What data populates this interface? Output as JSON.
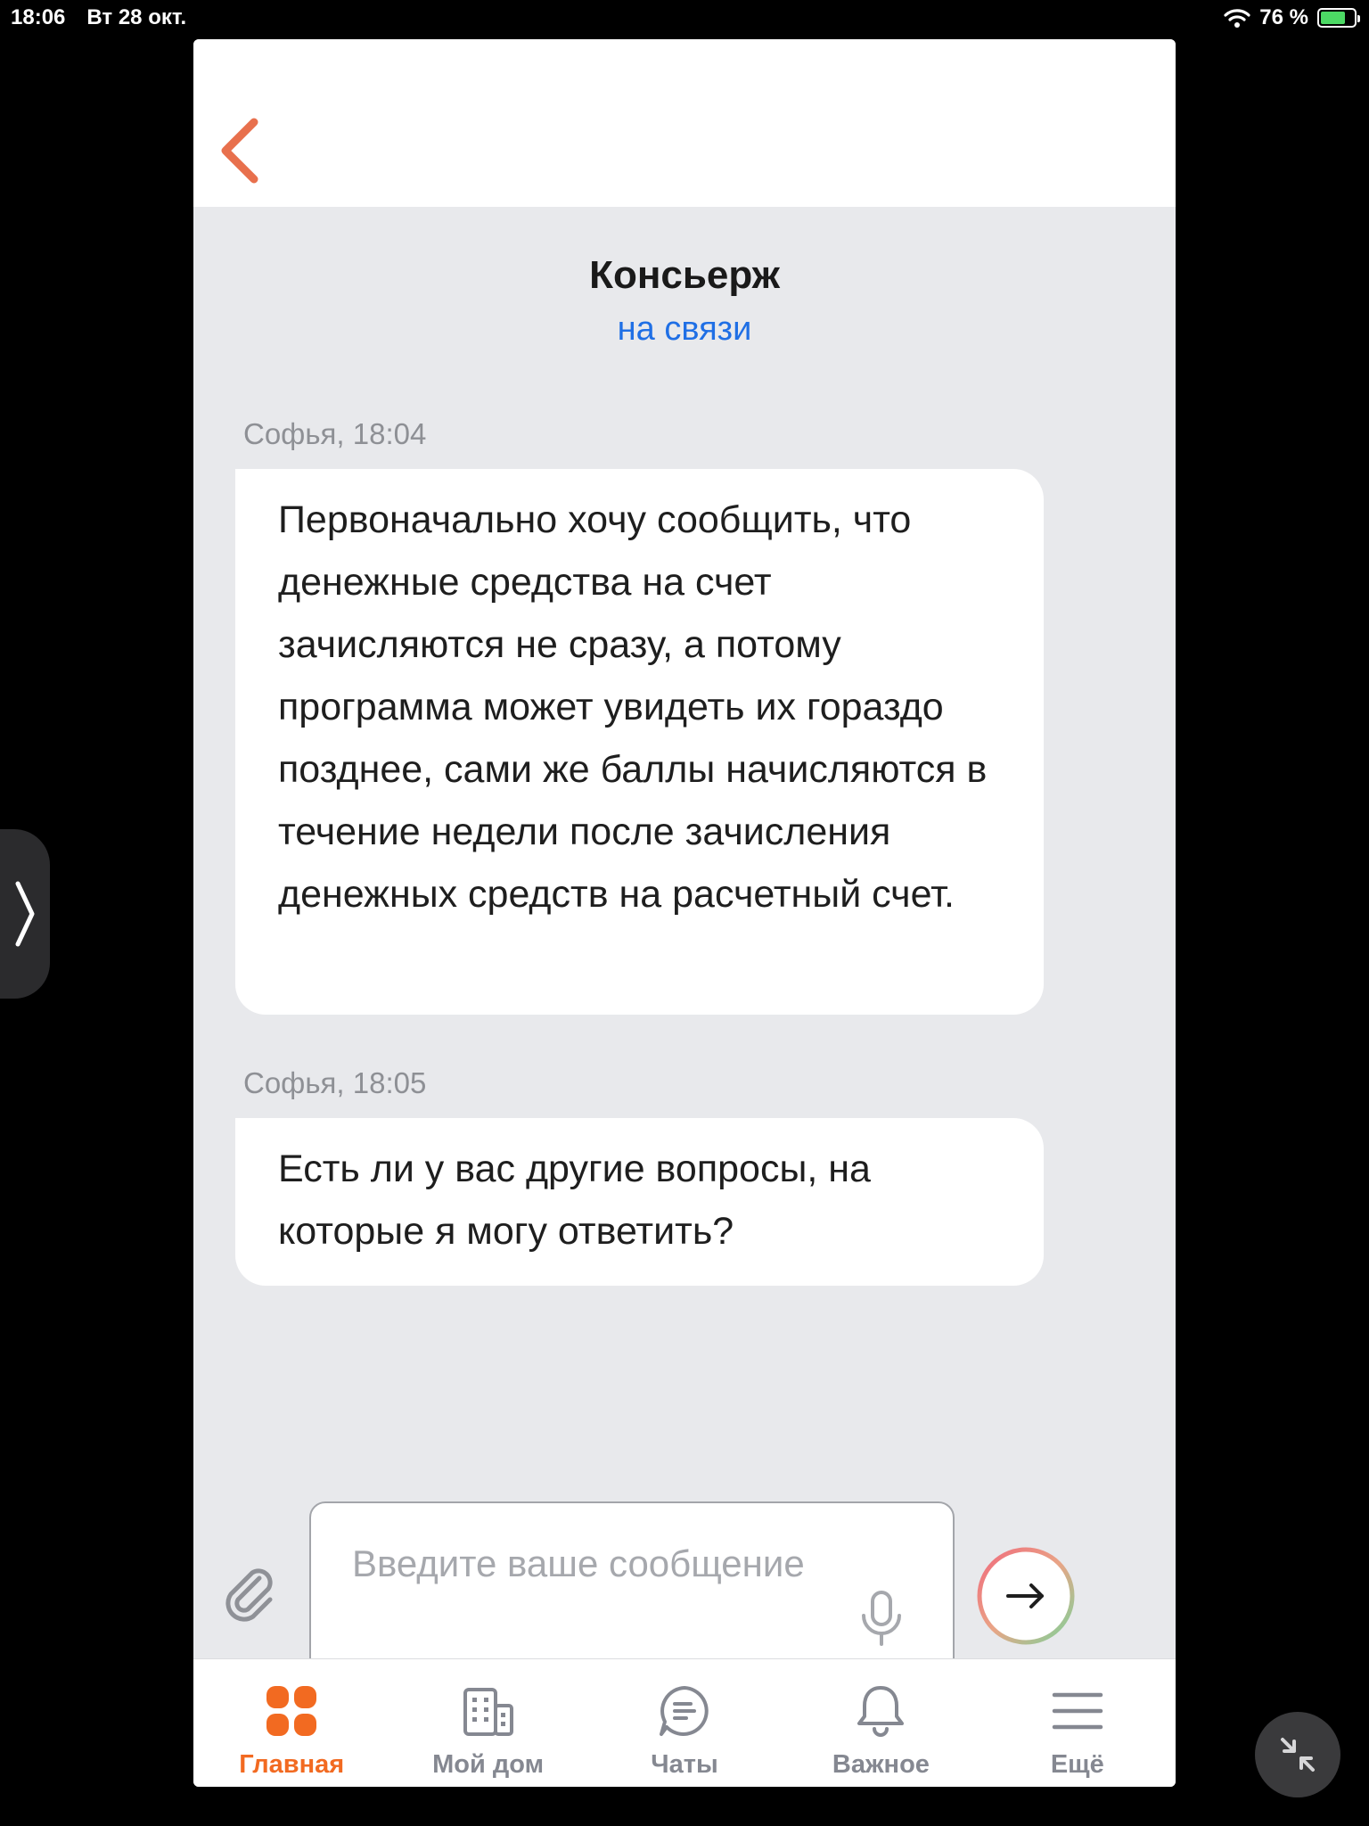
{
  "status_bar": {
    "time": "18:06",
    "date": "Вт 28 окт.",
    "battery": "76 %",
    "battery_level": 0.76
  },
  "header": {
    "title": "Консьерж",
    "status": "на связи"
  },
  "messages": [
    {
      "meta": "Софья, 18:04",
      "text": "Первоначально хочу сообщить, что денежные средства на счет зачисляются не сразу, а потому программа может увидеть их гораздо позднее, сами же баллы начисляются в течение недели после зачисления денежных средств на расчетный счет."
    },
    {
      "meta": "Софья, 18:05",
      "text": "Есть ли у вас другие вопросы, на которые я могу ответить?"
    }
  ],
  "composer": {
    "placeholder": "Введите ваше сообщение"
  },
  "tabs": [
    {
      "label": "Главная",
      "icon": "home-grid-icon",
      "active": true
    },
    {
      "label": "Мой дом",
      "icon": "building-icon",
      "active": false
    },
    {
      "label": "Чаты",
      "icon": "chat-icon",
      "active": false
    },
    {
      "label": "Важное",
      "icon": "bell-icon",
      "active": false
    },
    {
      "label": "Ещё",
      "icon": "menu-icon",
      "active": false
    }
  ],
  "colors": {
    "accent": "#f26a21",
    "link": "#1f6fe5",
    "background": "#e8e9ec"
  }
}
